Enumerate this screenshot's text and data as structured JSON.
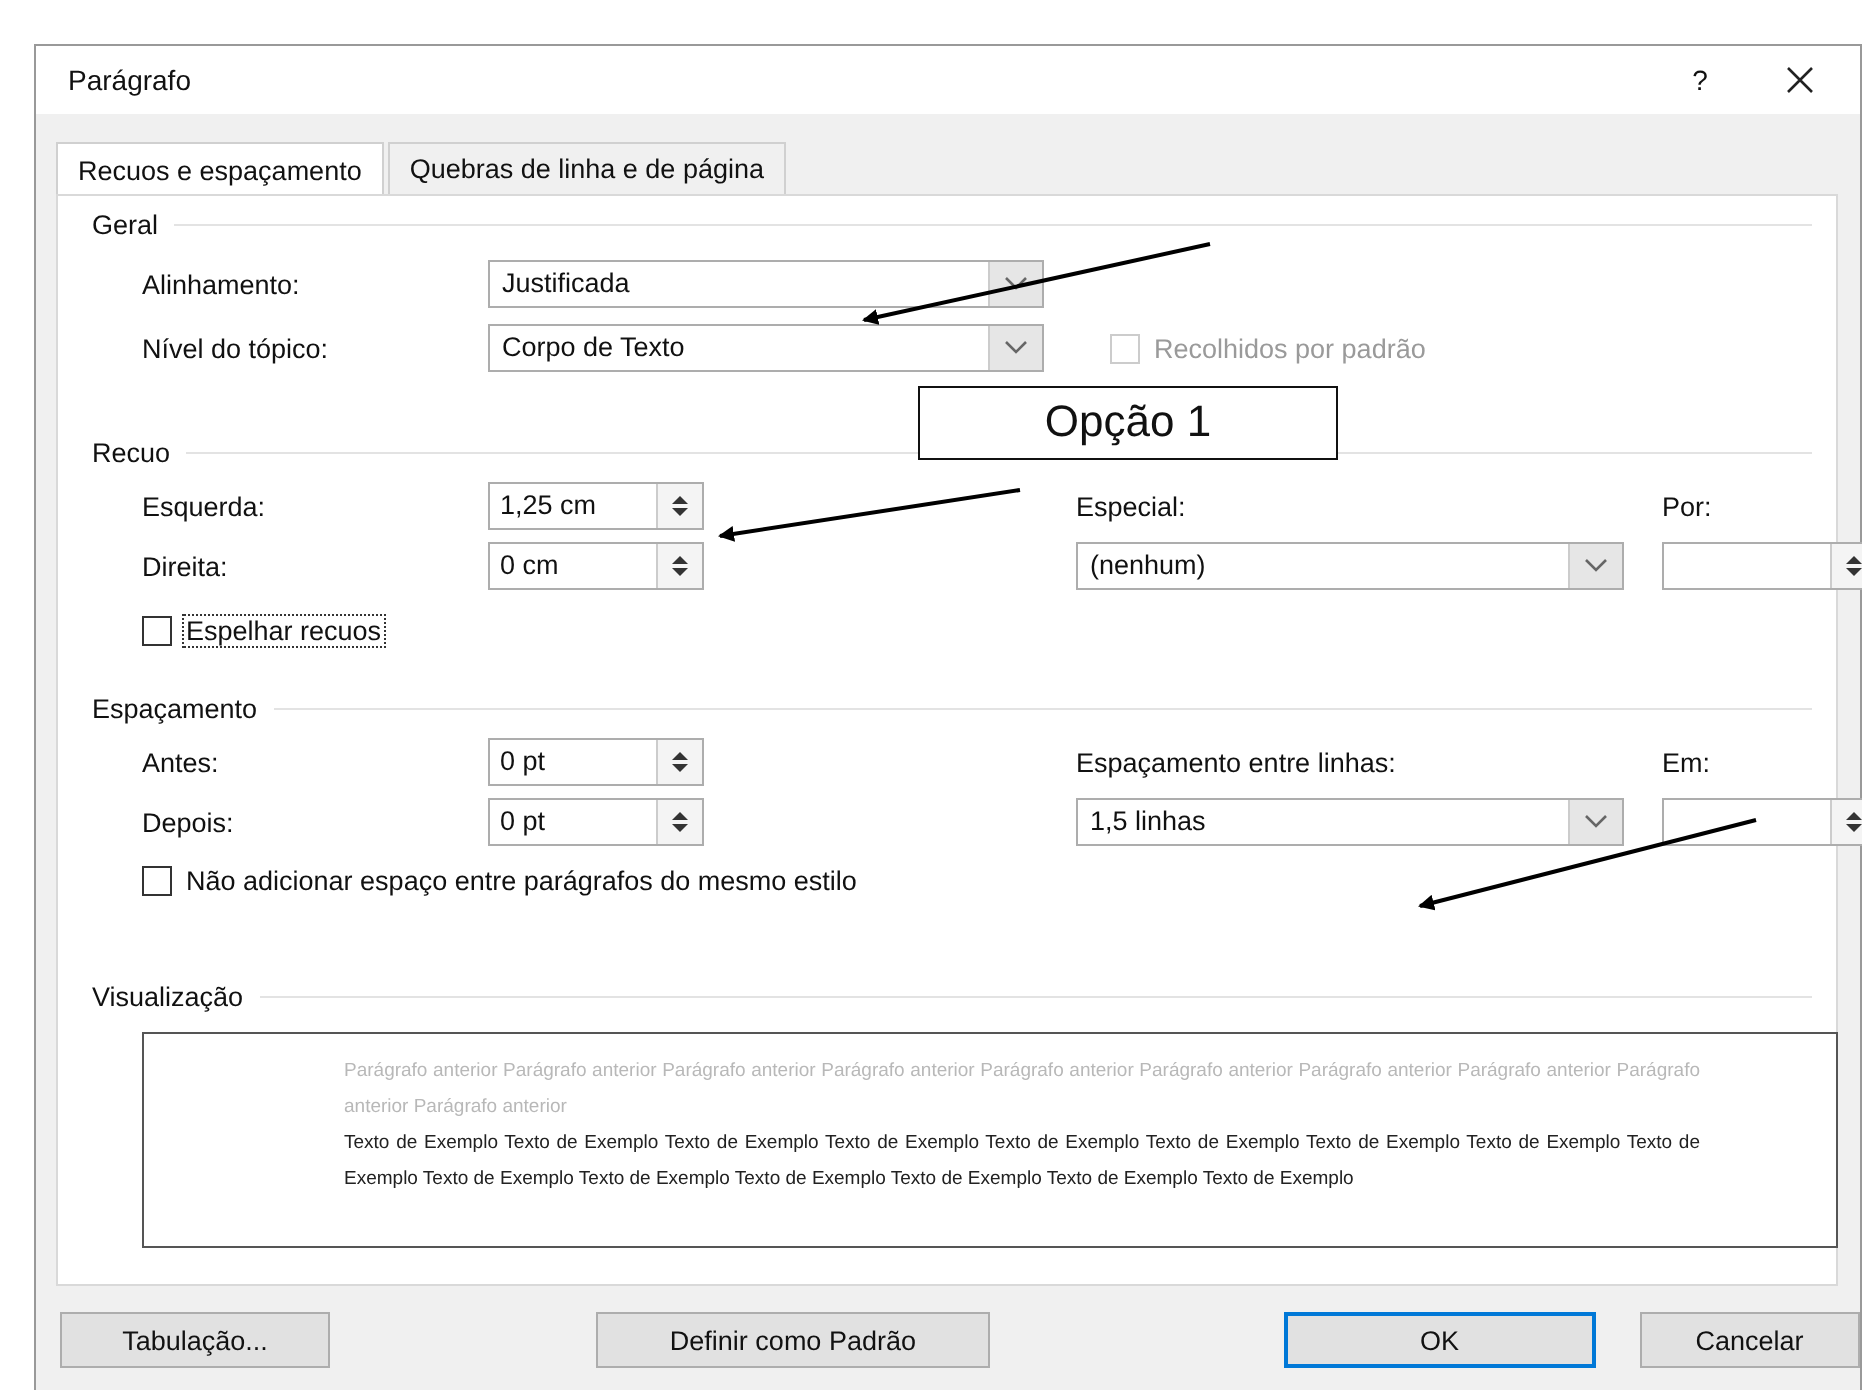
{
  "window": {
    "title": "Parágrafo",
    "help": "?"
  },
  "tabs": [
    {
      "label": "Recuos e espaçamento",
      "selected": true
    },
    {
      "label": "Quebras de linha e de página",
      "selected": false
    }
  ],
  "general": {
    "heading": "Geral",
    "alignment": {
      "label": "Alinhamento:",
      "value": "Justificada"
    },
    "outline_level": {
      "label": "Nível do tópico:",
      "value": "Corpo de Texto"
    },
    "collapsed": {
      "label": "Recolhidos por padrão",
      "checked": false,
      "disabled": true
    }
  },
  "indent": {
    "heading": "Recuo",
    "left": {
      "label": "Esquerda:",
      "value": "1,25 cm"
    },
    "right": {
      "label": "Direita:",
      "value": "0 cm"
    },
    "special": {
      "label": "Especial:",
      "value": "(nenhum)"
    },
    "by": {
      "label": "Por:"
    },
    "mirror": {
      "label": "Espelhar recuos",
      "checked": false,
      "focused": true
    }
  },
  "spacing": {
    "heading": "Espaçamento",
    "before": {
      "label": "Antes:",
      "value": "0 pt"
    },
    "after": {
      "label": "Depois:",
      "value": "0 pt"
    },
    "line_spacing": {
      "label": "Espaçamento entre linhas:",
      "value": "1,5 linhas"
    },
    "at": {
      "label": "Em:"
    },
    "no_space": {
      "label": "Não adicionar espaço entre parágrafos do mesmo estilo",
      "checked": false,
      "disabled": false
    }
  },
  "preview": {
    "heading": "Visualização",
    "previous_text": "Parágrafo anterior Parágrafo anterior Parágrafo anterior Parágrafo anterior Parágrafo anterior Parágrafo anterior Parágrafo anterior Parágrafo anterior Parágrafo anterior Parágrafo anterior",
    "sample_text": "Texto de Exemplo Texto de Exemplo Texto de Exemplo Texto de Exemplo Texto de Exemplo Texto de Exemplo Texto de Exemplo Texto de Exemplo Texto de Exemplo Texto de Exemplo Texto de Exemplo Texto de Exemplo Texto de Exemplo Texto de Exemplo Texto de Exemplo"
  },
  "buttons": [
    {
      "label": "Tabulação...",
      "default": false
    },
    {
      "label": "Definir como Padrão",
      "default": false
    },
    {
      "label": "OK",
      "default": true
    },
    {
      "label": "Cancelar",
      "default": false
    }
  ],
  "annotation": {
    "label": "Opção 1"
  }
}
